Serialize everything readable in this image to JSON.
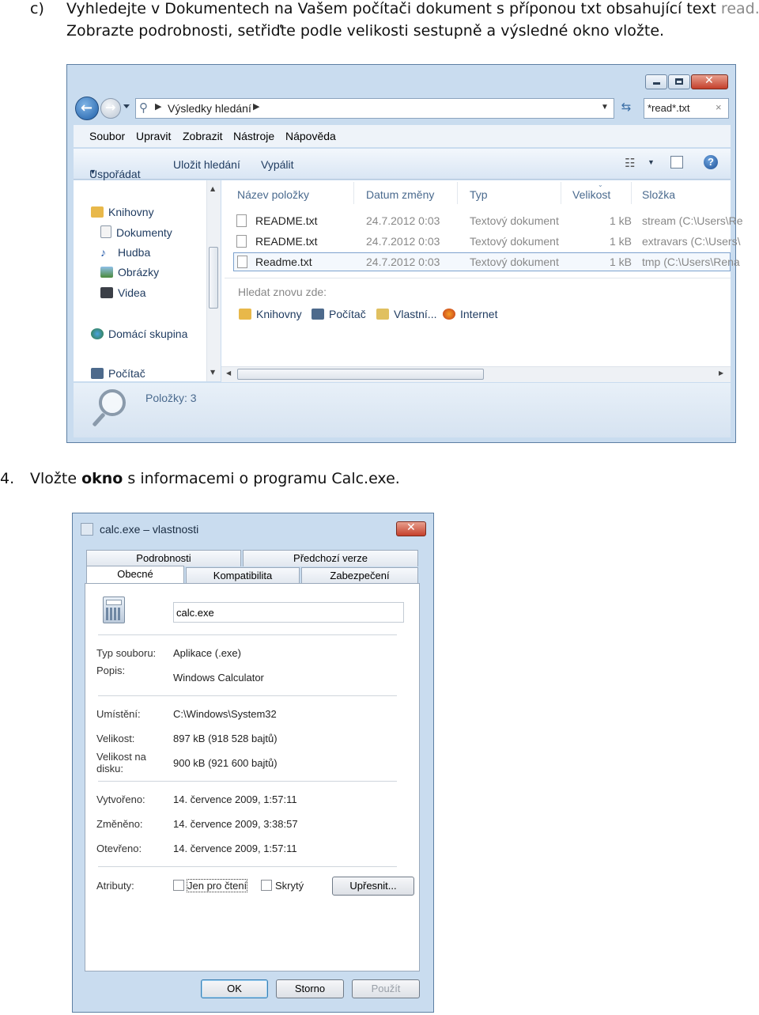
{
  "doc": {
    "task_c_marker": "c)",
    "task_c_line1": "Vyhledejte v Dokumentech na Vašem počítači dokument s příponou txt obsahující text",
    "task_c_line1_word": "read.",
    "task_c_line2": "Zobrazte podrobnosti, setřiďte podle velikosti sestupně a výsledné okno vložte.",
    "task4_marker": "4.",
    "task4_pre": "Vložte",
    "task4_bold": "okno",
    "task4_post": "s informacemi o programu Calc.exe."
  },
  "explorer": {
    "address": "Výsledky hledání",
    "search_value": "*read*.txt",
    "menu": [
      "Soubor",
      "Upravit",
      "Zobrazit",
      "Nástroje",
      "Nápověda"
    ],
    "toolbar": [
      "Uspořádat",
      "Uložit hledání",
      "Vypálit"
    ],
    "nav": {
      "libraries": "Knihovny",
      "items": [
        "Dokumenty",
        "Hudba",
        "Obrázky",
        "Videa"
      ],
      "homegroup": "Domácí skupina",
      "computer": "Počítač"
    },
    "columns": [
      "Název položky",
      "Datum změny",
      "Typ",
      "Velikost",
      "Složka"
    ],
    "rows": [
      {
        "name": "README.txt",
        "date": "24.7.2012 0:03",
        "type": "Textový dokument",
        "size": "1 kB",
        "folder": "stream (C:\\Users\\Re"
      },
      {
        "name": "README.txt",
        "date": "24.7.2012 0:03",
        "type": "Textový dokument",
        "size": "1 kB",
        "folder": "extravars (C:\\Users\\"
      },
      {
        "name": "Readme.txt",
        "date": "24.7.2012 0:03",
        "type": "Textový dokument",
        "size": "1 kB",
        "folder": "tmp (C:\\Users\\Rena"
      }
    ],
    "search_again_label": "Hledat znovu zde:",
    "search_again": [
      "Knihovny",
      "Počítač",
      "Vlastní...",
      "Internet"
    ],
    "status": "Položky: 3",
    "colors": {
      "frame": "#c9dcef",
      "accent": "#1e3a5f"
    }
  },
  "props": {
    "title": "calc.exe – vlastnosti",
    "tabs_back": [
      "Podrobnosti",
      "Předchozí verze"
    ],
    "tabs_front": [
      "Obecné",
      "Kompatibilita",
      "Zabezpečení"
    ],
    "filename": "calc.exe",
    "fields": {
      "type_label": "Typ souboru:",
      "type_value": "Aplikace (.exe)",
      "desc_label": "Popis:",
      "desc_value": "Windows Calculator",
      "loc_label": "Umístění:",
      "loc_value": "C:\\Windows\\System32",
      "size_label": "Velikost:",
      "size_value": "897 kB (918 528 bajtů)",
      "disk_label_1": "Velikost na",
      "disk_label_2": "disku:",
      "disk_value": "900 kB (921 600 bajtů)",
      "created_label": "Vytvořeno:",
      "created_value": "14. července 2009, 1:57:11",
      "modified_label": "Změněno:",
      "modified_value": "14. července 2009, 3:38:57",
      "opened_label": "Otevřeno:",
      "opened_value": "14. července 2009, 1:57:11",
      "attr_label": "Atributy:",
      "readonly": "Jen pro čtení",
      "hidden": "Skrytý",
      "advanced": "Upřesnit..."
    },
    "buttons": {
      "ok": "OK",
      "cancel": "Storno",
      "apply": "Použít"
    }
  }
}
